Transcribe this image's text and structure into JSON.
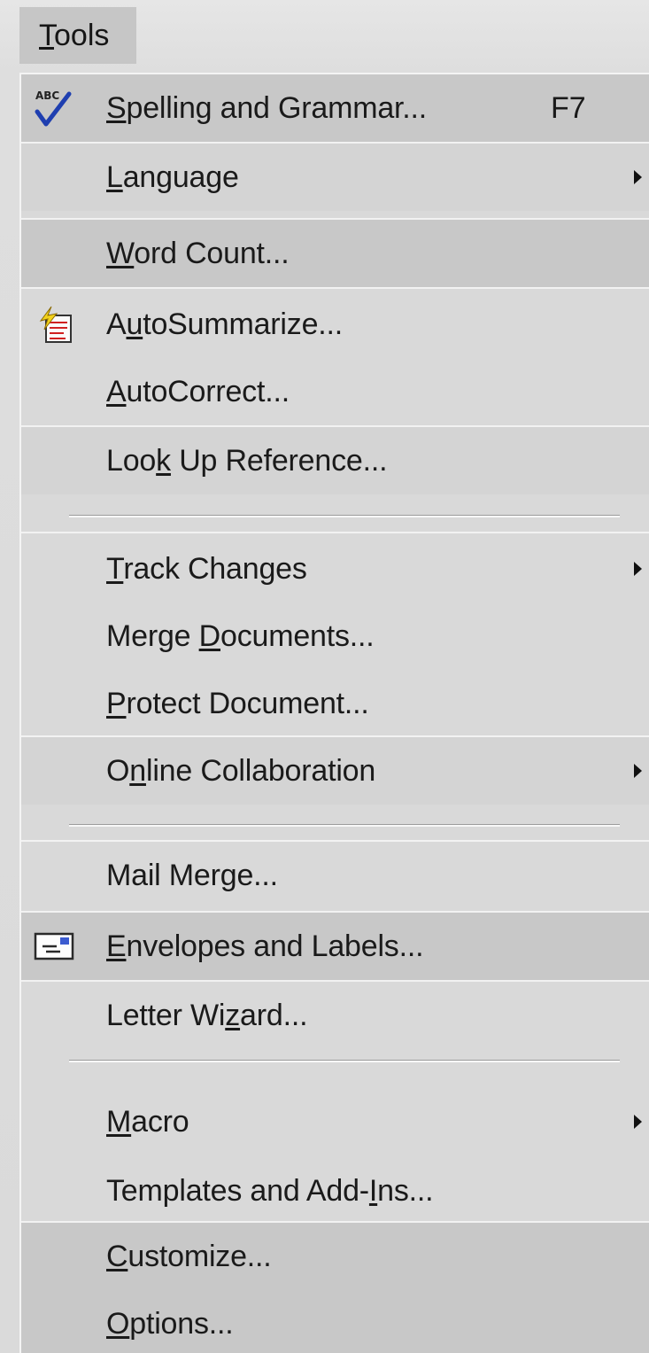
{
  "menu": {
    "title": "Tools",
    "title_mnemonic": "T",
    "title_rest": "ools"
  },
  "items": [
    {
      "key": "spelling",
      "pre": "",
      "mn": "S",
      "post": "pelling and Grammar...",
      "shortcut": "F7",
      "icon": "spelling-check-icon"
    },
    {
      "key": "language",
      "pre": "",
      "mn": "L",
      "post": "anguage",
      "submenu": true
    },
    {
      "key": "word-count",
      "pre": "",
      "mn": "W",
      "post": "ord Count..."
    },
    {
      "key": "autosummarize",
      "pre": "A",
      "mn": "u",
      "post": "toSummarize...",
      "icon": "autosummarize-icon"
    },
    {
      "key": "autocorrect",
      "pre": "",
      "mn": "A",
      "post": "utoCorrect..."
    },
    {
      "key": "look-up-reference",
      "pre": "Loo",
      "mn": "k",
      "post": " Up Reference..."
    },
    {
      "key": "track-changes",
      "pre": "",
      "mn": "T",
      "post": "rack Changes",
      "submenu": true
    },
    {
      "key": "merge-documents",
      "pre": "Merge ",
      "mn": "D",
      "post": "ocuments..."
    },
    {
      "key": "protect-document",
      "pre": "",
      "mn": "P",
      "post": "rotect Document..."
    },
    {
      "key": "online-collaboration",
      "pre": "O",
      "mn": "n",
      "post": "line Collaboration",
      "submenu": true
    },
    {
      "key": "mail-merge",
      "pre": "Mail Mer",
      "mn": "g",
      "post": "e..."
    },
    {
      "key": "envelopes-and-labels",
      "pre": "",
      "mn": "E",
      "post": "nvelopes and Labels...",
      "icon": "envelope-icon"
    },
    {
      "key": "letter-wizard",
      "pre": "Letter Wi",
      "mn": "z",
      "post": "ard..."
    },
    {
      "key": "macro",
      "pre": "",
      "mn": "M",
      "post": "acro",
      "submenu": true
    },
    {
      "key": "templates-and-add-ins",
      "pre": "Templates and Add-",
      "mn": "I",
      "post": "ns..."
    },
    {
      "key": "customize",
      "pre": "",
      "mn": "C",
      "post": "ustomize..."
    },
    {
      "key": "options",
      "pre": "",
      "mn": "O",
      "post": "ptions..."
    }
  ],
  "colors": {
    "menu_bg": "#d9d9d9",
    "highlight_bg": "#c8c8c8",
    "text": "#1a1a1a",
    "check_blue": "#1f3fb0"
  }
}
